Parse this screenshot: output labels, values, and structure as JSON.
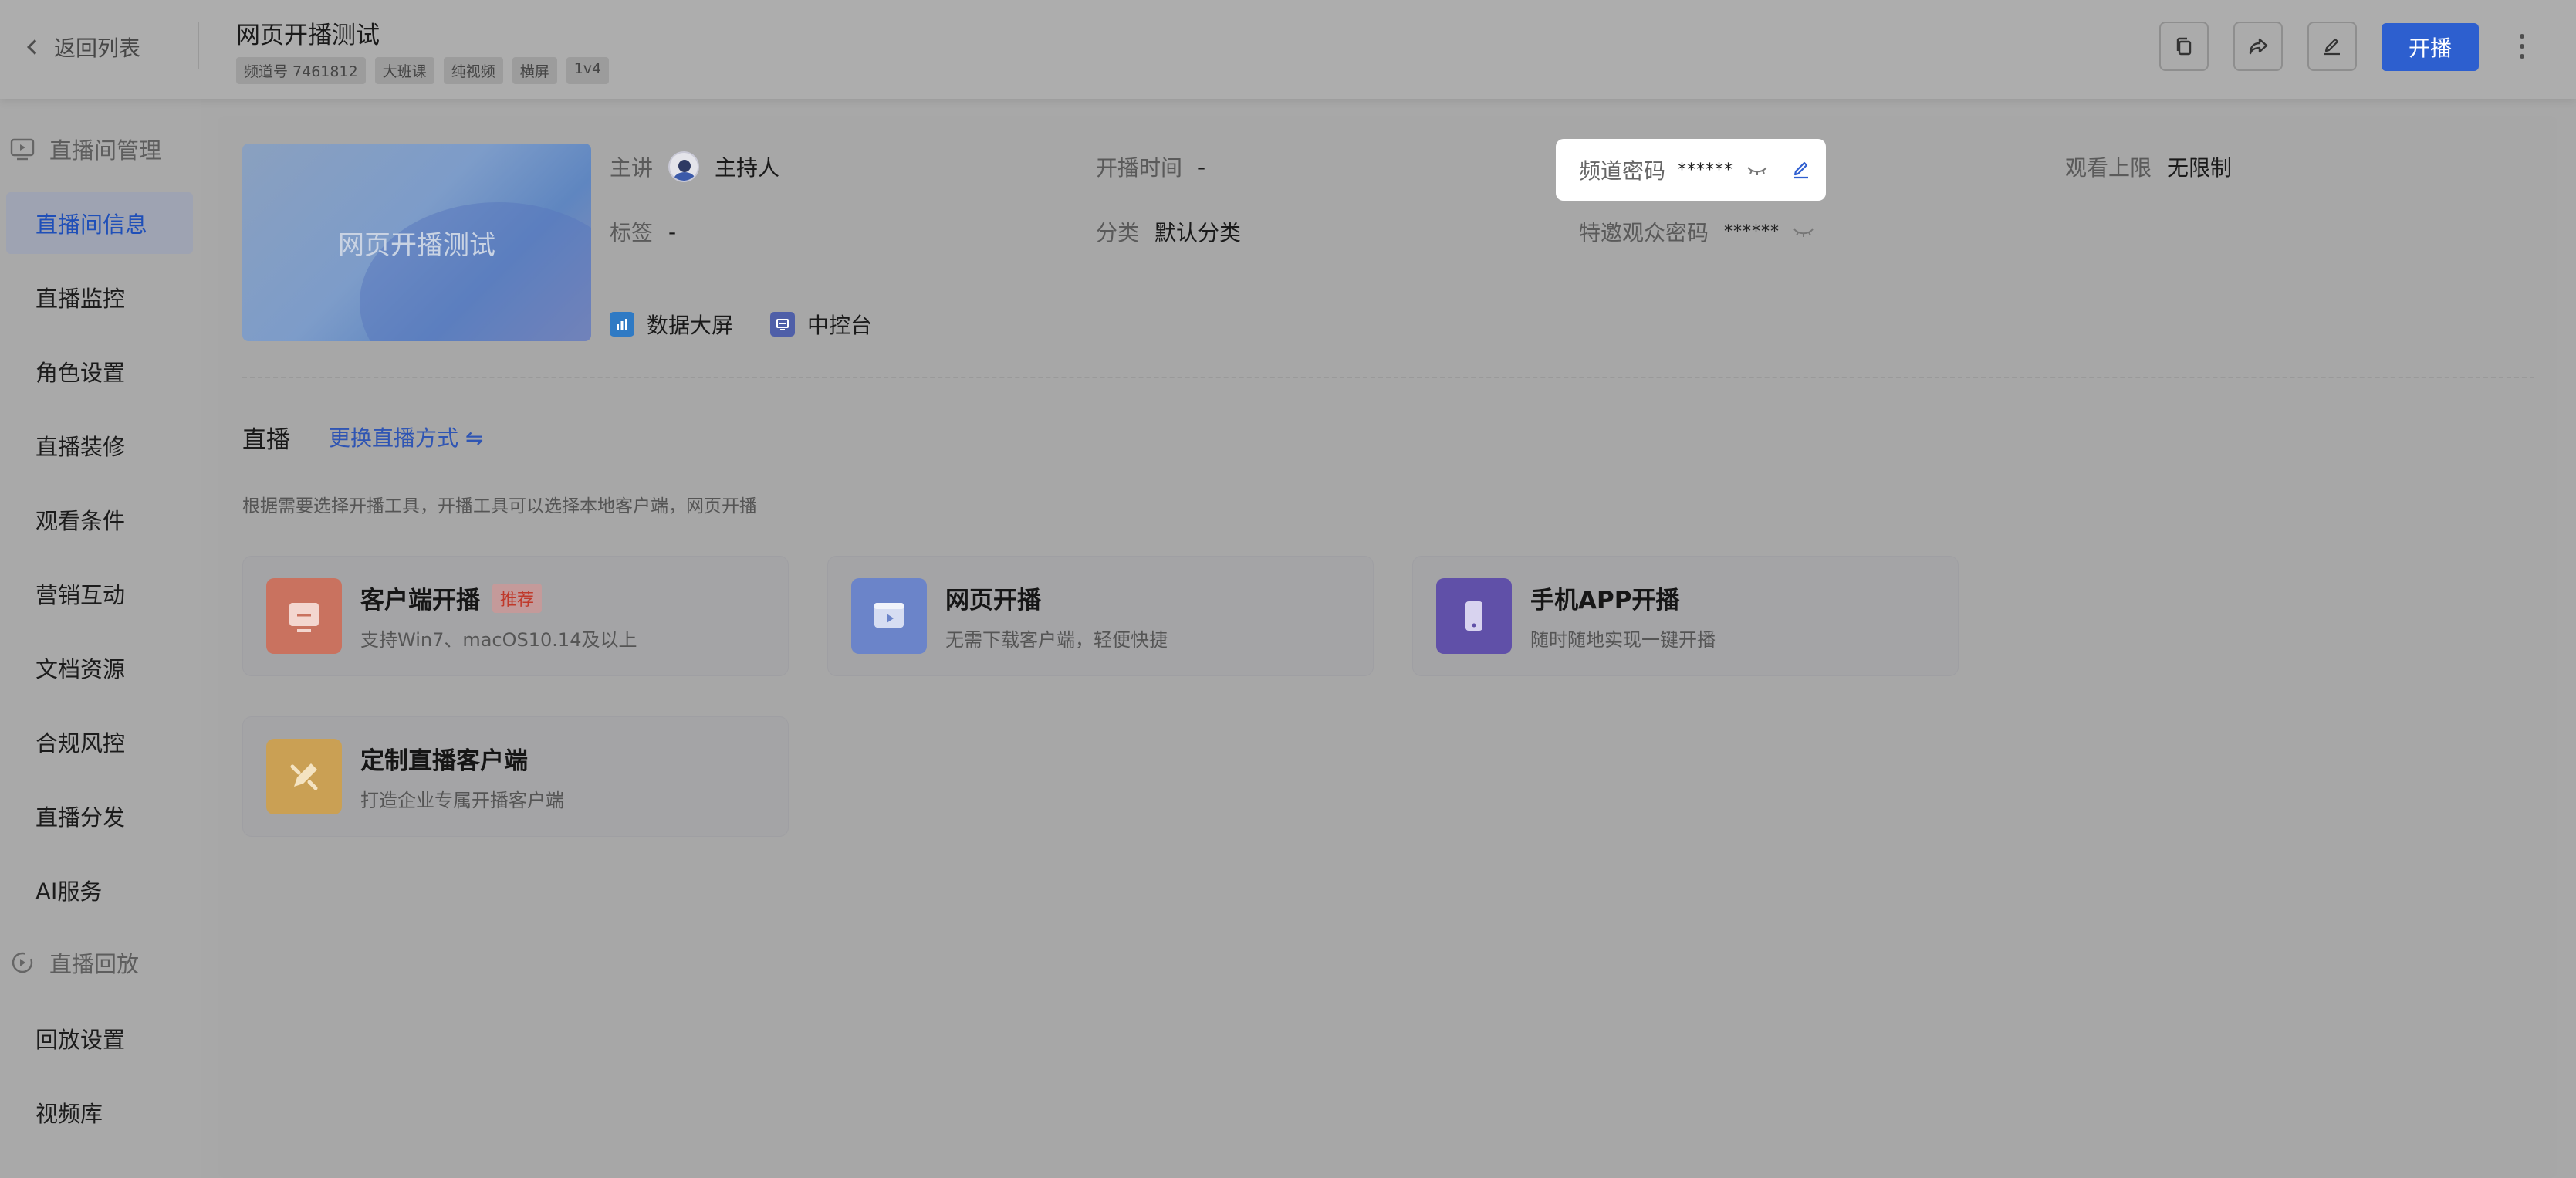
{
  "header": {
    "back_label": "返回列表",
    "title": "网页开播测试",
    "tags": [
      "频道号 7461812",
      "大班课",
      "纯视频",
      "横屏",
      "1v4"
    ],
    "start_button": "开播"
  },
  "sidebar": {
    "group_live": "直播间管理",
    "items": [
      "直播间信息",
      "直播监控",
      "角色设置",
      "直播装修",
      "观看条件",
      "营销互动",
      "文档资源",
      "合规风控",
      "直播分发",
      "AI服务"
    ],
    "group_playback": "直播回放",
    "playback_items": [
      "回放设置",
      "视频库"
    ]
  },
  "info": {
    "cover_text": "网页开播测试",
    "lecturer_key": "主讲",
    "lecturer_value": "主持人",
    "start_time_key": "开播时间",
    "start_time_value": "-",
    "channel_pwd_key": "频道密码",
    "channel_pwd_value": "******",
    "viewer_limit_key": "观看上限",
    "viewer_limit_value": "无限制",
    "tag_key": "标签",
    "tag_value": "-",
    "category_key": "分类",
    "category_value": "默认分类",
    "invite_pwd_key": "特邀观众密码",
    "invite_pwd_value": "******",
    "tool_data_screen": "数据大屏",
    "tool_console": "中控台"
  },
  "live": {
    "section_title": "直播",
    "switch_label": "更换直播方式 ⇋",
    "hint": "根据需要选择开播工具，开播工具可以选择本地客户端，网页开播",
    "cards": [
      {
        "title": "客户端开播",
        "badge": "推荐",
        "desc": "支持Win7、macOS10.14及以上",
        "color": "#c9725f"
      },
      {
        "title": "网页开播",
        "desc": "无需下载客户端，轻便快捷",
        "color": "#6b84c9"
      },
      {
        "title": "手机APP开播",
        "desc": "随时随地实现一键开播",
        "color": "#6050a8"
      },
      {
        "title": "定制直播客户端",
        "desc": "打造企业专属开播客户端",
        "color": "#caa054"
      }
    ]
  }
}
